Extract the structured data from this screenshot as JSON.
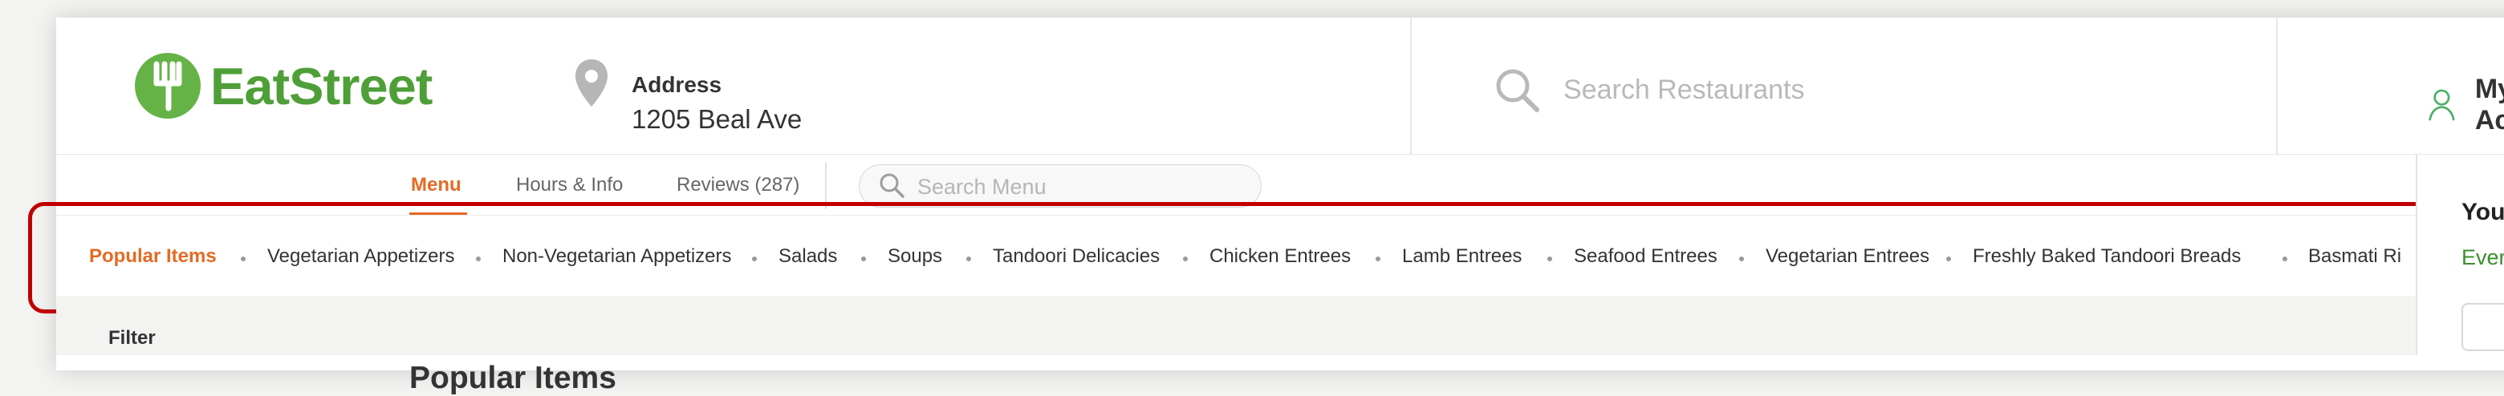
{
  "brand": {
    "name": "EatStreet",
    "accent_color": "#65b346",
    "active_tab_color": "#e46a24",
    "logo_icon": "fork-icon"
  },
  "header": {
    "address_label": "Address",
    "address_value": "1205 Beal Ave",
    "search_placeholder": "Search Restaurants",
    "account_label": "My Ac"
  },
  "tabs": [
    {
      "label": "Menu",
      "active": true
    },
    {
      "label": "Hours & Info",
      "active": false
    },
    {
      "label": "Reviews (287)",
      "active": false
    }
  ],
  "menu_search": {
    "placeholder": "Search Menu"
  },
  "categories": [
    {
      "label": "Popular Items",
      "active": true
    },
    {
      "label": "Vegetarian Appetizers",
      "active": false
    },
    {
      "label": "Non-Vegetarian Appetizers",
      "active": false
    },
    {
      "label": "Salads",
      "active": false
    },
    {
      "label": "Soups",
      "active": false
    },
    {
      "label": "Tandoori Delicacies",
      "active": false
    },
    {
      "label": "Chicken Entrees",
      "active": false
    },
    {
      "label": "Lamb Entrees",
      "active": false
    },
    {
      "label": "Seafood Entrees",
      "active": false
    },
    {
      "label": "Vegetarian Entrees",
      "active": false
    },
    {
      "label": "Freshly Baked Tandoori Breads",
      "active": false
    },
    {
      "label": "Basmati Ri",
      "active": false
    }
  ],
  "filter": {
    "label": "Filter"
  },
  "main": {
    "section_heading": "Popular Items"
  },
  "order_panel": {
    "title": "Your",
    "subtitle": "Everg"
  }
}
